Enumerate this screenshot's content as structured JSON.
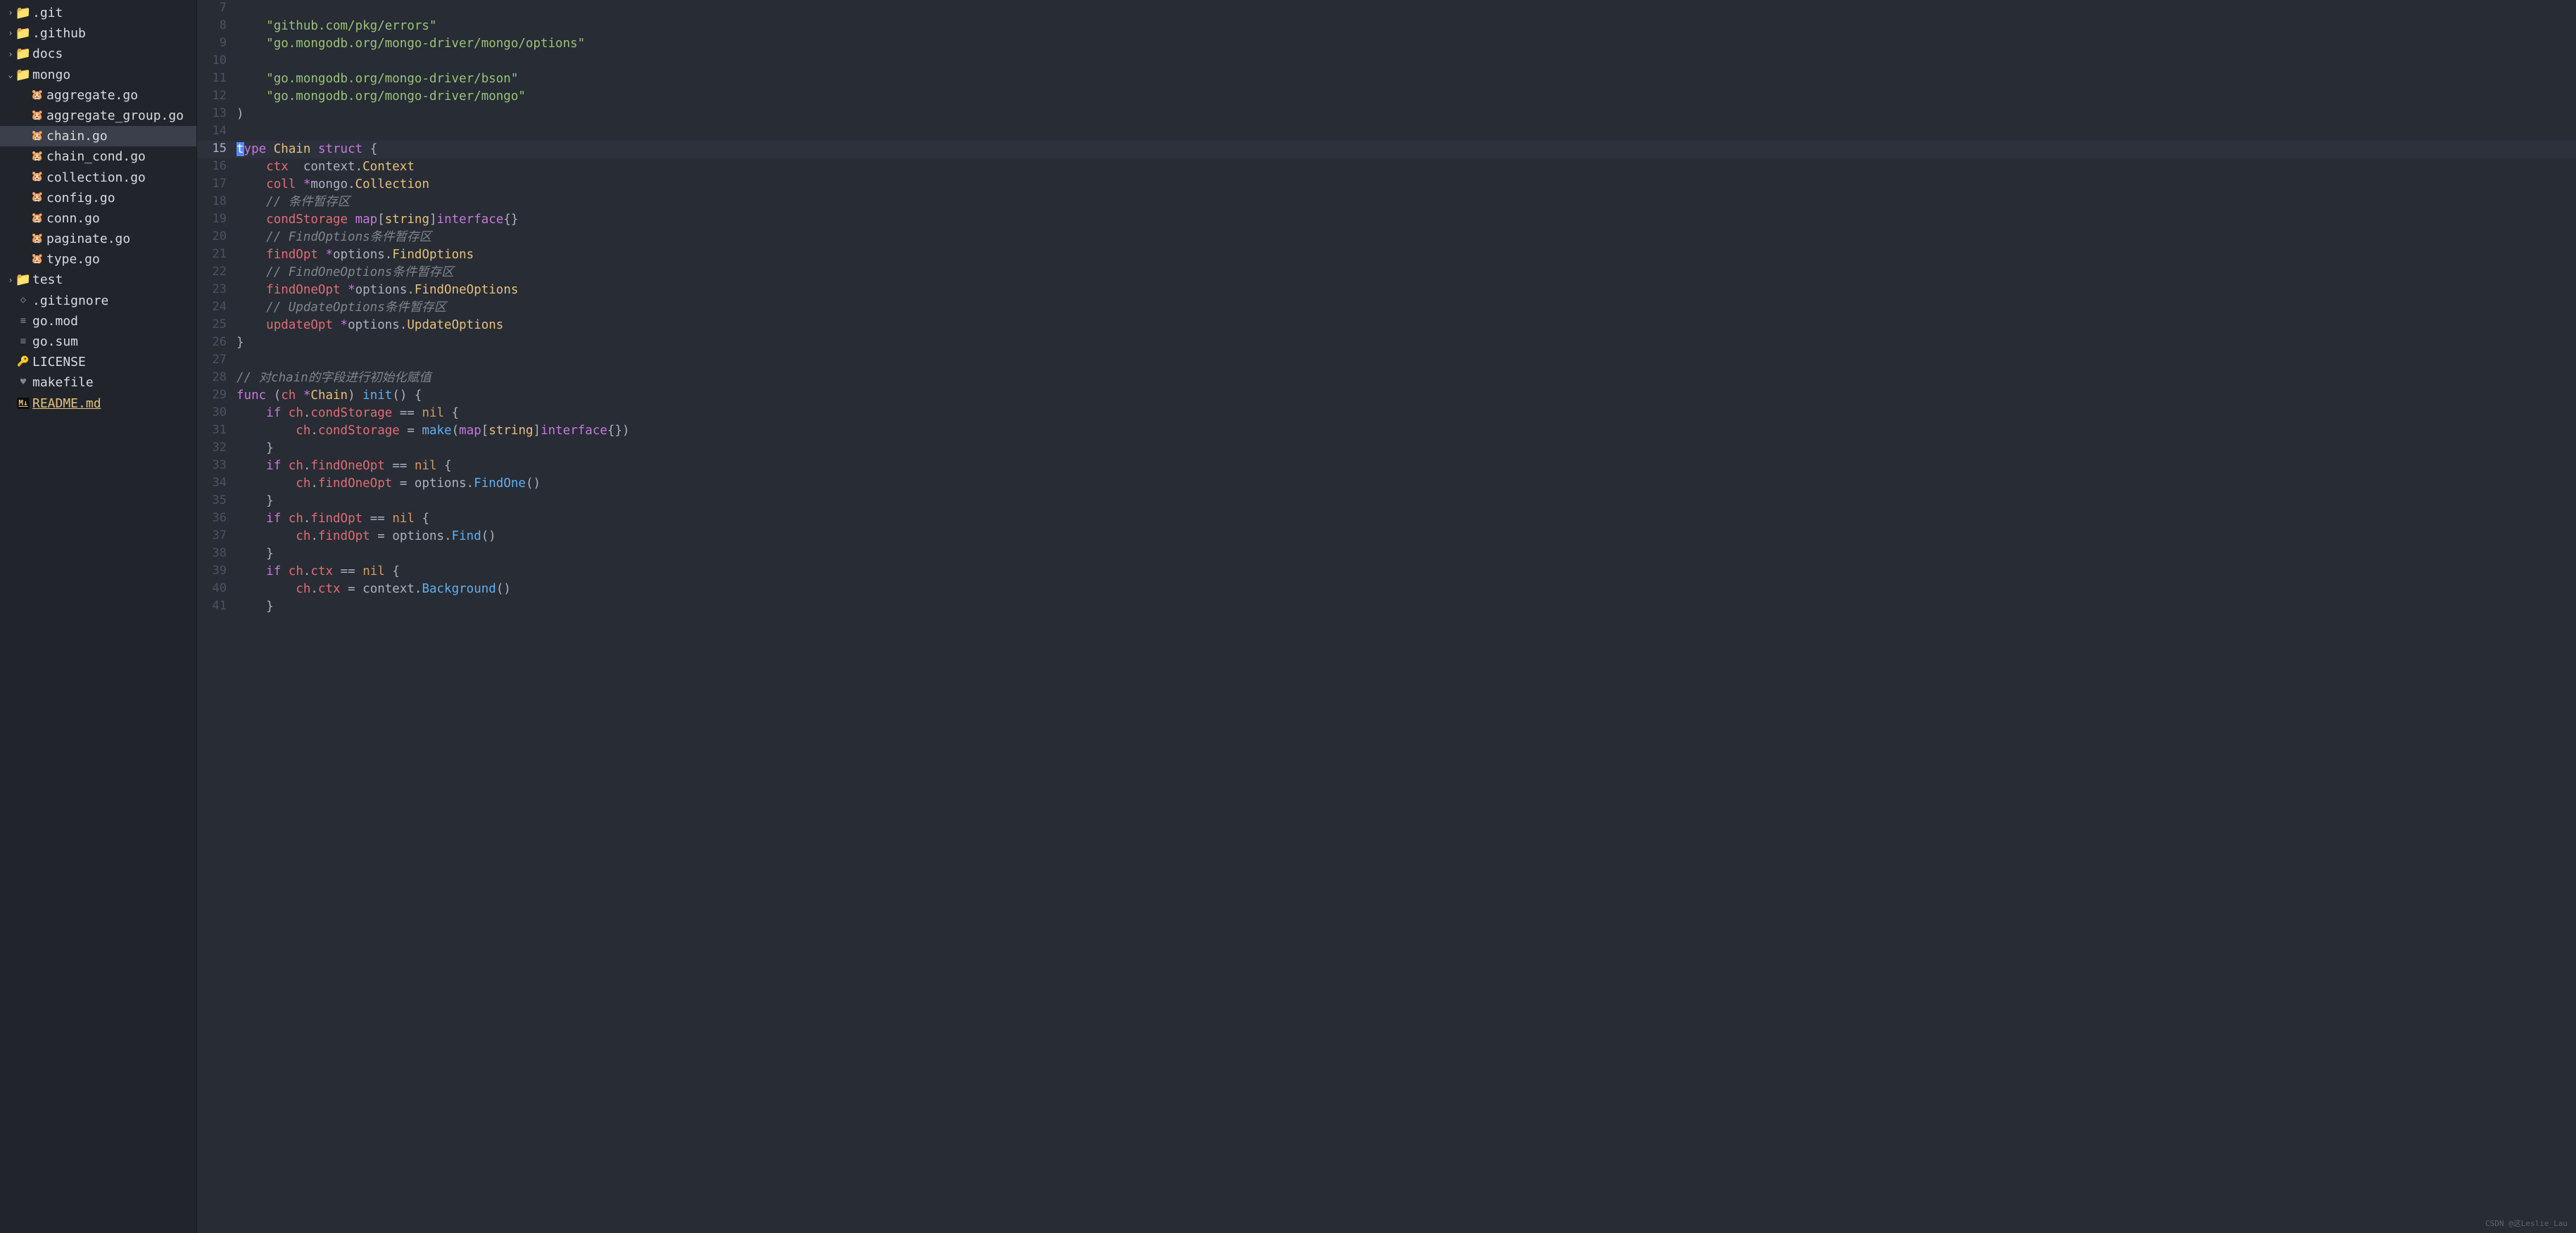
{
  "sidebar": {
    "items": [
      {
        "level": 0,
        "chevron": "›",
        "iconType": "folder",
        "label": ".git"
      },
      {
        "level": 0,
        "chevron": "›",
        "iconType": "folder",
        "label": ".github"
      },
      {
        "level": 0,
        "chevron": "›",
        "iconType": "folder",
        "label": "docs"
      },
      {
        "level": 0,
        "chevron": "⌄",
        "iconType": "folder",
        "label": "mongo"
      },
      {
        "level": 1,
        "chevron": "",
        "iconType": "go",
        "label": "aggregate.go"
      },
      {
        "level": 1,
        "chevron": "",
        "iconType": "go",
        "label": "aggregate_group.go"
      },
      {
        "level": 1,
        "chevron": "",
        "iconType": "go",
        "label": "chain.go",
        "active": true
      },
      {
        "level": 1,
        "chevron": "",
        "iconType": "go",
        "label": "chain_cond.go"
      },
      {
        "level": 1,
        "chevron": "",
        "iconType": "go",
        "label": "collection.go"
      },
      {
        "level": 1,
        "chevron": "",
        "iconType": "go",
        "label": "config.go"
      },
      {
        "level": 1,
        "chevron": "",
        "iconType": "go",
        "label": "conn.go"
      },
      {
        "level": 1,
        "chevron": "",
        "iconType": "go",
        "label": "paginate.go"
      },
      {
        "level": 1,
        "chevron": "",
        "iconType": "go",
        "label": "type.go"
      },
      {
        "level": 0,
        "chevron": "›",
        "iconType": "folder-test",
        "label": "test"
      },
      {
        "level": 0,
        "chevron": "",
        "iconType": "dot",
        "label": ".gitignore"
      },
      {
        "level": 0,
        "chevron": "",
        "iconType": "file",
        "label": "go.mod"
      },
      {
        "level": 0,
        "chevron": "",
        "iconType": "file",
        "label": "go.sum"
      },
      {
        "level": 0,
        "chevron": "",
        "iconType": "lock",
        "label": "LICENSE"
      },
      {
        "level": 0,
        "chevron": "",
        "iconType": "heart",
        "label": "makefile"
      },
      {
        "level": 0,
        "chevron": "",
        "iconType": "md",
        "label": "README.md",
        "changed": true
      }
    ]
  },
  "editor": {
    "lines": [
      {
        "n": 7,
        "tokens": []
      },
      {
        "n": 8,
        "tokens": [
          {
            "t": "    ",
            "c": "plain"
          },
          {
            "t": "\"github.com/pkg/errors\"",
            "c": "str"
          }
        ]
      },
      {
        "n": 9,
        "tokens": [
          {
            "t": "    ",
            "c": "plain"
          },
          {
            "t": "\"go.mongodb.org/mongo-driver/mongo/options\"",
            "c": "str"
          }
        ]
      },
      {
        "n": 10,
        "tokens": []
      },
      {
        "n": 11,
        "tokens": [
          {
            "t": "    ",
            "c": "plain"
          },
          {
            "t": "\"go.mongodb.org/mongo-driver/bson\"",
            "c": "str"
          }
        ]
      },
      {
        "n": 12,
        "tokens": [
          {
            "t": "    ",
            "c": "plain"
          },
          {
            "t": "\"go.mongodb.org/mongo-driver/mongo\"",
            "c": "str"
          }
        ]
      },
      {
        "n": 13,
        "tokens": [
          {
            "t": ")",
            "c": "punct"
          }
        ]
      },
      {
        "n": 14,
        "tokens": []
      },
      {
        "n": 15,
        "hl": true,
        "tokens": [
          {
            "t": "t",
            "c": "cursor"
          },
          {
            "t": "ype",
            "c": "kw"
          },
          {
            "t": " ",
            "c": "plain"
          },
          {
            "t": "Chain",
            "c": "type"
          },
          {
            "t": " ",
            "c": "plain"
          },
          {
            "t": "struct",
            "c": "kw"
          },
          {
            "t": " {",
            "c": "punct"
          }
        ]
      },
      {
        "n": 16,
        "tokens": [
          {
            "t": "    ",
            "c": "plain"
          },
          {
            "t": "ctx",
            "c": "prop"
          },
          {
            "t": "  context.",
            "c": "plain"
          },
          {
            "t": "Context",
            "c": "type"
          }
        ]
      },
      {
        "n": 17,
        "tokens": [
          {
            "t": "    ",
            "c": "plain"
          },
          {
            "t": "coll",
            "c": "prop"
          },
          {
            "t": " ",
            "c": "plain"
          },
          {
            "t": "*",
            "c": "kw"
          },
          {
            "t": "mongo.",
            "c": "plain"
          },
          {
            "t": "Collection",
            "c": "type"
          }
        ]
      },
      {
        "n": 18,
        "tokens": [
          {
            "t": "    ",
            "c": "plain"
          },
          {
            "t": "// 条件暂存区",
            "c": "com"
          }
        ]
      },
      {
        "n": 19,
        "tokens": [
          {
            "t": "    ",
            "c": "plain"
          },
          {
            "t": "condStorage",
            "c": "prop"
          },
          {
            "t": " ",
            "c": "plain"
          },
          {
            "t": "map",
            "c": "kw"
          },
          {
            "t": "[",
            "c": "punct"
          },
          {
            "t": "string",
            "c": "type"
          },
          {
            "t": "]",
            "c": "punct"
          },
          {
            "t": "interface",
            "c": "kw"
          },
          {
            "t": "{}",
            "c": "punct"
          }
        ]
      },
      {
        "n": 20,
        "tokens": [
          {
            "t": "    ",
            "c": "plain"
          },
          {
            "t": "// FindOptions条件暂存区",
            "c": "com"
          }
        ]
      },
      {
        "n": 21,
        "tokens": [
          {
            "t": "    ",
            "c": "plain"
          },
          {
            "t": "findOpt",
            "c": "prop"
          },
          {
            "t": " ",
            "c": "plain"
          },
          {
            "t": "*",
            "c": "kw"
          },
          {
            "t": "options.",
            "c": "plain"
          },
          {
            "t": "FindOptions",
            "c": "type"
          }
        ]
      },
      {
        "n": 22,
        "tokens": [
          {
            "t": "    ",
            "c": "plain"
          },
          {
            "t": "// FindOneOptions条件暂存区",
            "c": "com"
          }
        ]
      },
      {
        "n": 23,
        "tokens": [
          {
            "t": "    ",
            "c": "plain"
          },
          {
            "t": "findOneOpt",
            "c": "prop"
          },
          {
            "t": " ",
            "c": "plain"
          },
          {
            "t": "*",
            "c": "kw"
          },
          {
            "t": "options.",
            "c": "plain"
          },
          {
            "t": "FindOneOptions",
            "c": "type"
          }
        ]
      },
      {
        "n": 24,
        "tokens": [
          {
            "t": "    ",
            "c": "plain"
          },
          {
            "t": "// UpdateOptions条件暂存区",
            "c": "com"
          }
        ]
      },
      {
        "n": 25,
        "tokens": [
          {
            "t": "    ",
            "c": "plain"
          },
          {
            "t": "updateOpt",
            "c": "prop"
          },
          {
            "t": " ",
            "c": "plain"
          },
          {
            "t": "*",
            "c": "kw"
          },
          {
            "t": "options.",
            "c": "plain"
          },
          {
            "t": "UpdateOptions",
            "c": "type"
          }
        ]
      },
      {
        "n": 26,
        "tokens": [
          {
            "t": "}",
            "c": "punct"
          }
        ]
      },
      {
        "n": 27,
        "tokens": []
      },
      {
        "n": 28,
        "tokens": [
          {
            "t": "// 对chain的字段进行初始化赋值",
            "c": "com"
          }
        ]
      },
      {
        "n": 29,
        "tokens": [
          {
            "t": "func",
            "c": "kw"
          },
          {
            "t": " (",
            "c": "punct"
          },
          {
            "t": "ch",
            "c": "id"
          },
          {
            "t": " ",
            "c": "plain"
          },
          {
            "t": "*",
            "c": "kw"
          },
          {
            "t": "Chain",
            "c": "type"
          },
          {
            "t": ") ",
            "c": "punct"
          },
          {
            "t": "init",
            "c": "func"
          },
          {
            "t": "() {",
            "c": "punct"
          }
        ]
      },
      {
        "n": 30,
        "tokens": [
          {
            "t": "    ",
            "c": "plain"
          },
          {
            "t": "if",
            "c": "kw"
          },
          {
            "t": " ",
            "c": "plain"
          },
          {
            "t": "ch",
            "c": "id"
          },
          {
            "t": ".",
            "c": "punct"
          },
          {
            "t": "condStorage",
            "c": "prop"
          },
          {
            "t": " ",
            "c": "plain"
          },
          {
            "t": "==",
            "c": "punct"
          },
          {
            "t": " ",
            "c": "plain"
          },
          {
            "t": "nil",
            "c": "const"
          },
          {
            "t": " {",
            "c": "punct"
          }
        ]
      },
      {
        "n": 31,
        "tokens": [
          {
            "t": "        ",
            "c": "plain"
          },
          {
            "t": "ch",
            "c": "id"
          },
          {
            "t": ".",
            "c": "punct"
          },
          {
            "t": "condStorage",
            "c": "prop"
          },
          {
            "t": " ",
            "c": "plain"
          },
          {
            "t": "=",
            "c": "punct"
          },
          {
            "t": " ",
            "c": "plain"
          },
          {
            "t": "make",
            "c": "func"
          },
          {
            "t": "(",
            "c": "punct"
          },
          {
            "t": "map",
            "c": "kw"
          },
          {
            "t": "[",
            "c": "punct"
          },
          {
            "t": "string",
            "c": "type"
          },
          {
            "t": "]",
            "c": "punct"
          },
          {
            "t": "interface",
            "c": "kw"
          },
          {
            "t": "{})",
            "c": "punct"
          }
        ]
      },
      {
        "n": 32,
        "tokens": [
          {
            "t": "    ",
            "c": "plain"
          },
          {
            "t": "}",
            "c": "punct"
          }
        ]
      },
      {
        "n": 33,
        "tokens": [
          {
            "t": "    ",
            "c": "plain"
          },
          {
            "t": "if",
            "c": "kw"
          },
          {
            "t": " ",
            "c": "plain"
          },
          {
            "t": "ch",
            "c": "id"
          },
          {
            "t": ".",
            "c": "punct"
          },
          {
            "t": "findOneOpt",
            "c": "prop"
          },
          {
            "t": " ",
            "c": "plain"
          },
          {
            "t": "==",
            "c": "punct"
          },
          {
            "t": " ",
            "c": "plain"
          },
          {
            "t": "nil",
            "c": "const"
          },
          {
            "t": " {",
            "c": "punct"
          }
        ]
      },
      {
        "n": 34,
        "tokens": [
          {
            "t": "        ",
            "c": "plain"
          },
          {
            "t": "ch",
            "c": "id"
          },
          {
            "t": ".",
            "c": "punct"
          },
          {
            "t": "findOneOpt",
            "c": "prop"
          },
          {
            "t": " ",
            "c": "plain"
          },
          {
            "t": "=",
            "c": "punct"
          },
          {
            "t": " options.",
            "c": "plain"
          },
          {
            "t": "FindOne",
            "c": "func"
          },
          {
            "t": "()",
            "c": "punct"
          }
        ]
      },
      {
        "n": 35,
        "tokens": [
          {
            "t": "    ",
            "c": "plain"
          },
          {
            "t": "}",
            "c": "punct"
          }
        ]
      },
      {
        "n": 36,
        "tokens": [
          {
            "t": "    ",
            "c": "plain"
          },
          {
            "t": "if",
            "c": "kw"
          },
          {
            "t": " ",
            "c": "plain"
          },
          {
            "t": "ch",
            "c": "id"
          },
          {
            "t": ".",
            "c": "punct"
          },
          {
            "t": "findOpt",
            "c": "prop"
          },
          {
            "t": " ",
            "c": "plain"
          },
          {
            "t": "==",
            "c": "punct"
          },
          {
            "t": " ",
            "c": "plain"
          },
          {
            "t": "nil",
            "c": "const"
          },
          {
            "t": " {",
            "c": "punct"
          }
        ]
      },
      {
        "n": 37,
        "tokens": [
          {
            "t": "        ",
            "c": "plain"
          },
          {
            "t": "ch",
            "c": "id"
          },
          {
            "t": ".",
            "c": "punct"
          },
          {
            "t": "findOpt",
            "c": "prop"
          },
          {
            "t": " ",
            "c": "plain"
          },
          {
            "t": "=",
            "c": "punct"
          },
          {
            "t": " options.",
            "c": "plain"
          },
          {
            "t": "Find",
            "c": "func"
          },
          {
            "t": "()",
            "c": "punct"
          }
        ]
      },
      {
        "n": 38,
        "tokens": [
          {
            "t": "    ",
            "c": "plain"
          },
          {
            "t": "}",
            "c": "punct"
          }
        ]
      },
      {
        "n": 39,
        "tokens": [
          {
            "t": "    ",
            "c": "plain"
          },
          {
            "t": "if",
            "c": "kw"
          },
          {
            "t": " ",
            "c": "plain"
          },
          {
            "t": "ch",
            "c": "id"
          },
          {
            "t": ".",
            "c": "punct"
          },
          {
            "t": "ctx",
            "c": "prop"
          },
          {
            "t": " ",
            "c": "plain"
          },
          {
            "t": "==",
            "c": "punct"
          },
          {
            "t": " ",
            "c": "plain"
          },
          {
            "t": "nil",
            "c": "const"
          },
          {
            "t": " {",
            "c": "punct"
          }
        ]
      },
      {
        "n": 40,
        "tokens": [
          {
            "t": "        ",
            "c": "plain"
          },
          {
            "t": "ch",
            "c": "id"
          },
          {
            "t": ".",
            "c": "punct"
          },
          {
            "t": "ctx",
            "c": "prop"
          },
          {
            "t": " ",
            "c": "plain"
          },
          {
            "t": "=",
            "c": "punct"
          },
          {
            "t": " context.",
            "c": "plain"
          },
          {
            "t": "Background",
            "c": "func"
          },
          {
            "t": "()",
            "c": "punct"
          }
        ]
      },
      {
        "n": 41,
        "tokens": [
          {
            "t": "    ",
            "c": "plain"
          },
          {
            "t": "}",
            "c": "punct"
          }
        ]
      }
    ]
  },
  "watermark": "CSDN @这Leslie_Lau"
}
